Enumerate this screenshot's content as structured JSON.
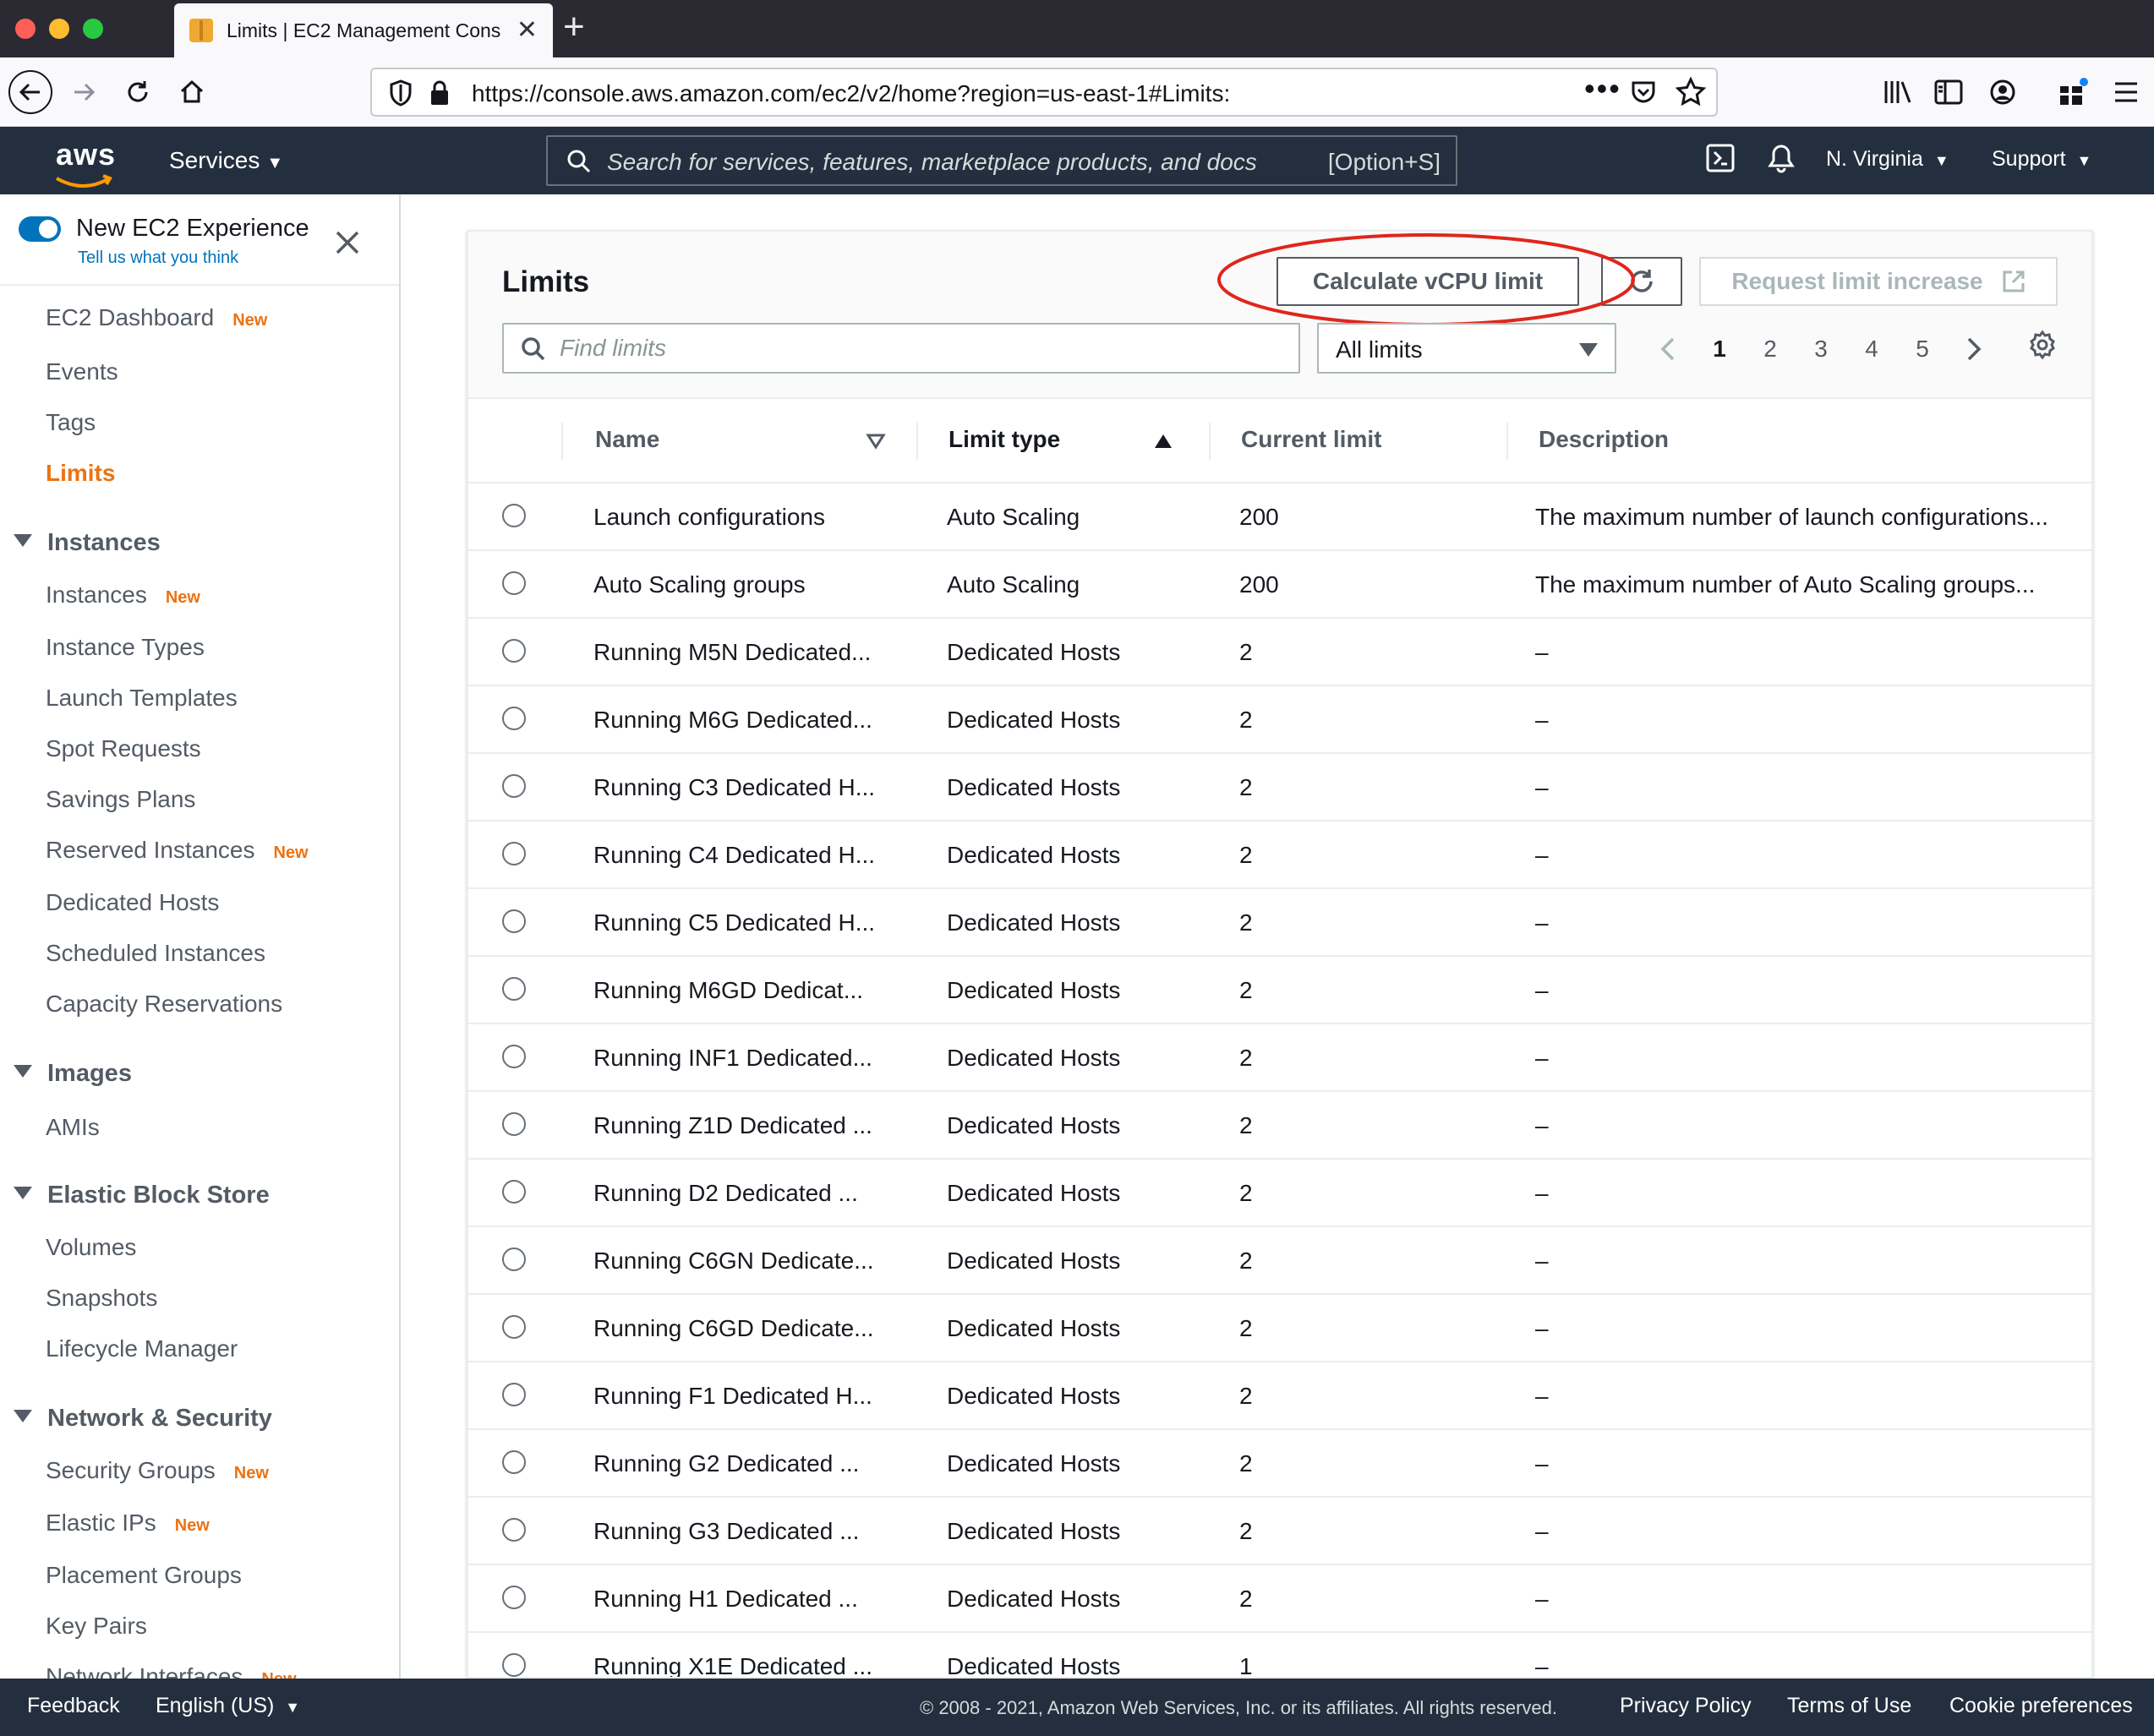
{
  "browser": {
    "tab_title": "Limits | EC2 Management Cons",
    "url": "https://console.aws.amazon.com/ec2/v2/home?region=us-east-1#Limits:",
    "traffic_colors": [
      "#ff5f57",
      "#febc2e",
      "#28c840"
    ]
  },
  "aws_header": {
    "logo": "aws",
    "services_label": "Services",
    "search_placeholder": "Search for services, features, marketplace products, and docs",
    "search_shortcut": "[Option+S]",
    "region": "N. Virginia",
    "support": "Support"
  },
  "sidebar": {
    "new_experience_label": "New EC2 Experience",
    "tell_us": "Tell us what you think",
    "new_badge": "New",
    "top_items": [
      {
        "label": "EC2 Dashboard",
        "new": true
      },
      {
        "label": "Events",
        "new": false
      },
      {
        "label": "Tags",
        "new": false
      },
      {
        "label": "Limits",
        "new": false,
        "active": true
      }
    ],
    "sections": [
      {
        "title": "Instances",
        "items": [
          {
            "label": "Instances",
            "new": true
          },
          {
            "label": "Instance Types",
            "new": false
          },
          {
            "label": "Launch Templates",
            "new": false
          },
          {
            "label": "Spot Requests",
            "new": false
          },
          {
            "label": "Savings Plans",
            "new": false
          },
          {
            "label": "Reserved Instances",
            "new": true
          },
          {
            "label": "Dedicated Hosts",
            "new": false
          },
          {
            "label": "Scheduled Instances",
            "new": false
          },
          {
            "label": "Capacity Reservations",
            "new": false
          }
        ]
      },
      {
        "title": "Images",
        "items": [
          {
            "label": "AMIs",
            "new": false
          }
        ]
      },
      {
        "title": "Elastic Block Store",
        "items": [
          {
            "label": "Volumes",
            "new": false
          },
          {
            "label": "Snapshots",
            "new": false
          },
          {
            "label": "Lifecycle Manager",
            "new": false
          }
        ]
      },
      {
        "title": "Network & Security",
        "items": [
          {
            "label": "Security Groups",
            "new": true
          },
          {
            "label": "Elastic IPs",
            "new": true
          },
          {
            "label": "Placement Groups",
            "new": false
          },
          {
            "label": "Key Pairs",
            "new": false
          },
          {
            "label": "Network Interfaces",
            "new": true
          }
        ]
      }
    ]
  },
  "main": {
    "title": "Limits",
    "calculate_button": "Calculate vCPU limit",
    "request_button": "Request limit increase",
    "filter_placeholder": "Find limits",
    "select_value": "All limits",
    "pages": [
      "1",
      "2",
      "3",
      "4",
      "5"
    ],
    "current_page": "1",
    "annotation_color": "#e0261b",
    "columns": {
      "name": "Name",
      "limit_type": "Limit type",
      "current_limit": "Current limit",
      "description": "Description"
    },
    "rows": [
      {
        "name": "Launch configurations",
        "type": "Auto Scaling",
        "current": "200",
        "description": "The maximum number of launch configurations..."
      },
      {
        "name": "Auto Scaling groups",
        "type": "Auto Scaling",
        "current": "200",
        "description": "The maximum number of Auto Scaling groups..."
      },
      {
        "name": "Running M5N Dedicated...",
        "type": "Dedicated Hosts",
        "current": "2",
        "description": "–"
      },
      {
        "name": "Running M6G Dedicated...",
        "type": "Dedicated Hosts",
        "current": "2",
        "description": "–"
      },
      {
        "name": "Running C3 Dedicated H...",
        "type": "Dedicated Hosts",
        "current": "2",
        "description": "–"
      },
      {
        "name": "Running C4 Dedicated H...",
        "type": "Dedicated Hosts",
        "current": "2",
        "description": "–"
      },
      {
        "name": "Running C5 Dedicated H...",
        "type": "Dedicated Hosts",
        "current": "2",
        "description": "–"
      },
      {
        "name": "Running M6GD Dedicat...",
        "type": "Dedicated Hosts",
        "current": "2",
        "description": "–"
      },
      {
        "name": "Running INF1 Dedicated...",
        "type": "Dedicated Hosts",
        "current": "2",
        "description": "–"
      },
      {
        "name": "Running Z1D Dedicated ...",
        "type": "Dedicated Hosts",
        "current": "2",
        "description": "–"
      },
      {
        "name": "Running D2 Dedicated ...",
        "type": "Dedicated Hosts",
        "current": "2",
        "description": "–"
      },
      {
        "name": "Running C6GN Dedicate...",
        "type": "Dedicated Hosts",
        "current": "2",
        "description": "–"
      },
      {
        "name": "Running C6GD Dedicate...",
        "type": "Dedicated Hosts",
        "current": "2",
        "description": "–"
      },
      {
        "name": "Running F1 Dedicated H...",
        "type": "Dedicated Hosts",
        "current": "2",
        "description": "–"
      },
      {
        "name": "Running G2 Dedicated ...",
        "type": "Dedicated Hosts",
        "current": "2",
        "description": "–"
      },
      {
        "name": "Running G3 Dedicated ...",
        "type": "Dedicated Hosts",
        "current": "2",
        "description": "–"
      },
      {
        "name": "Running H1 Dedicated ...",
        "type": "Dedicated Hosts",
        "current": "2",
        "description": "–"
      },
      {
        "name": "Running X1E Dedicated ...",
        "type": "Dedicated Hosts",
        "current": "1",
        "description": "–"
      }
    ]
  },
  "footer": {
    "feedback": "Feedback",
    "language": "English (US)",
    "copyright": "© 2008 - 2021, Amazon Web Services, Inc. or its affiliates. All rights reserved.",
    "privacy": "Privacy Policy",
    "terms": "Terms of Use",
    "cookies": "Cookie preferences"
  }
}
